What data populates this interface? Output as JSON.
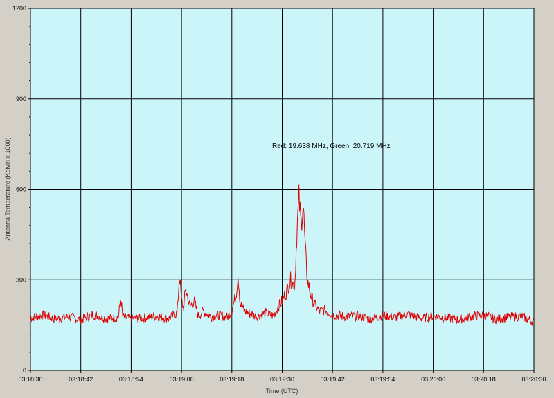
{
  "chart_data": {
    "type": "line",
    "title": "",
    "xlabel": "Time (UTC)",
    "ylabel": "Antenna Temperature (Kelvin x 1000)",
    "ylim": [
      0,
      1200
    ],
    "yticks": [
      0,
      300,
      600,
      900,
      1200
    ],
    "xticks": [
      "03:18:30",
      "03:18:42",
      "03:18:54",
      "03:19:06",
      "03:19:18",
      "03:19:30",
      "03:19:42",
      "03:19:54",
      "03:20:06",
      "03:20:18",
      "03:20:30"
    ],
    "xlim": [
      "03:18:30",
      "03:20:30"
    ],
    "grid": true,
    "background_color": "#ccf5fa",
    "series": [
      {
        "color": "#dd0000",
        "x": [
          "03:18:30",
          "03:18:33",
          "03:18:36",
          "03:18:39",
          "03:18:42",
          "03:18:45",
          "03:18:48",
          "03:18:51",
          "03:18:51.5",
          "03:18:52",
          "03:18:54",
          "03:18:57",
          "03:19:00",
          "03:19:03",
          "03:19:05",
          "03:19:05.5",
          "03:19:06",
          "03:19:06.5",
          "03:19:07",
          "03:19:08",
          "03:19:09",
          "03:19:10",
          "03:19:11",
          "03:19:12",
          "03:19:13",
          "03:19:15",
          "03:19:17",
          "03:19:18",
          "03:19:19",
          "03:19:19.5",
          "03:19:20",
          "03:19:21",
          "03:19:22",
          "03:19:24",
          "03:19:26",
          "03:19:28",
          "03:19:29",
          "03:19:30",
          "03:19:31",
          "03:19:32",
          "03:19:33",
          "03:19:33.5",
          "03:19:34",
          "03:19:34.5",
          "03:19:35",
          "03:19:35.5",
          "03:19:36",
          "03:19:37",
          "03:19:38",
          "03:19:39",
          "03:19:40",
          "03:19:42",
          "03:19:45",
          "03:19:48",
          "03:19:51",
          "03:19:54",
          "03:19:57",
          "03:20:00",
          "03:20:03",
          "03:20:06",
          "03:20:09",
          "03:20:12",
          "03:20:15",
          "03:20:18",
          "03:20:21",
          "03:20:24",
          "03:20:27",
          "03:20:30"
        ],
        "values": [
          175,
          182,
          170,
          178,
          168,
          185,
          172,
          176,
          240,
          178,
          170,
          174,
          180,
          172,
          190,
          320,
          230,
          205,
          270,
          210,
          230,
          180,
          195,
          190,
          178,
          182,
          176,
          200,
          250,
          320,
          220,
          196,
          190,
          178,
          190,
          180,
          210,
          230,
          260,
          300,
          280,
          460,
          570,
          480,
          560,
          400,
          300,
          240,
          210,
          195,
          200,
          185,
          178,
          180,
          170,
          182,
          175,
          186,
          172,
          180,
          174,
          168,
          178,
          182,
          170,
          176,
          180,
          160
        ]
      }
    ],
    "annotations": [
      {
        "text": "Red: 19.638 MHz, Green: 20.719 MHz",
        "x": "03:19:30",
        "y": 740
      }
    ]
  }
}
